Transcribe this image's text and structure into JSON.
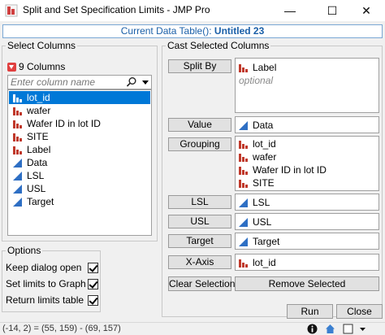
{
  "window": {
    "title": "Split and Set Specification Limits - JMP Pro",
    "controls": {
      "minimize": "—",
      "maximize": "☐",
      "close": "✕"
    }
  },
  "current_table": {
    "label": "Current Data Table():",
    "name": "Untitled 23"
  },
  "select_columns": {
    "legend": "Select Columns",
    "count_label": "9 Columns",
    "search_placeholder": "Enter column name",
    "columns": [
      {
        "name": "lot_id",
        "icon": "nominal-bar-icon",
        "selected": true
      },
      {
        "name": "wafer",
        "icon": "nominal-bar-icon",
        "selected": false
      },
      {
        "name": "Wafer ID in lot ID",
        "icon": "nominal-bar-icon",
        "selected": false
      },
      {
        "name": "SITE",
        "icon": "nominal-bar-icon",
        "selected": false
      },
      {
        "name": "Label",
        "icon": "nominal-bar-icon",
        "selected": false
      },
      {
        "name": "Data",
        "icon": "continuous-triangle-icon",
        "selected": false
      },
      {
        "name": "LSL",
        "icon": "continuous-triangle-icon",
        "selected": false
      },
      {
        "name": "USL",
        "icon": "continuous-triangle-icon",
        "selected": false
      },
      {
        "name": "Target",
        "icon": "continuous-triangle-icon",
        "selected": false
      }
    ]
  },
  "options": {
    "legend": "Options",
    "items": [
      {
        "label": "Keep dialog open",
        "checked": true
      },
      {
        "label": "Set limits to Graph",
        "checked": true
      },
      {
        "label": "Return limits table",
        "checked": true
      }
    ]
  },
  "cast": {
    "legend": "Cast Selected Columns",
    "split_by": {
      "button": "Split By",
      "items": [
        "Label"
      ],
      "optional": "optional"
    },
    "value": {
      "button": "Value",
      "items": [
        "Data"
      ]
    },
    "grouping": {
      "button": "Grouping",
      "items": [
        "lot_id",
        "wafer",
        "Wafer ID in lot ID",
        "SITE"
      ]
    },
    "lsl": {
      "button": "LSL",
      "items": [
        "LSL"
      ]
    },
    "usl": {
      "button": "USL",
      "items": [
        "USL"
      ]
    },
    "target": {
      "button": "Target",
      "items": [
        "Target"
      ]
    },
    "x_axis": {
      "button": "X-Axis",
      "items": [
        "lot_id"
      ]
    },
    "clear_selection": "Clear Selection",
    "remove_selected": "Remove Selected"
  },
  "actions": {
    "run": "Run",
    "close": "Close"
  },
  "status": {
    "text": "(-14, 2) = (55, 159) - (69, 157)"
  },
  "colors": {
    "accent": "#0078d7",
    "nominal": "#c0392b",
    "continuous": "#2e6fc4",
    "title_blue": "#1a5fa8"
  }
}
